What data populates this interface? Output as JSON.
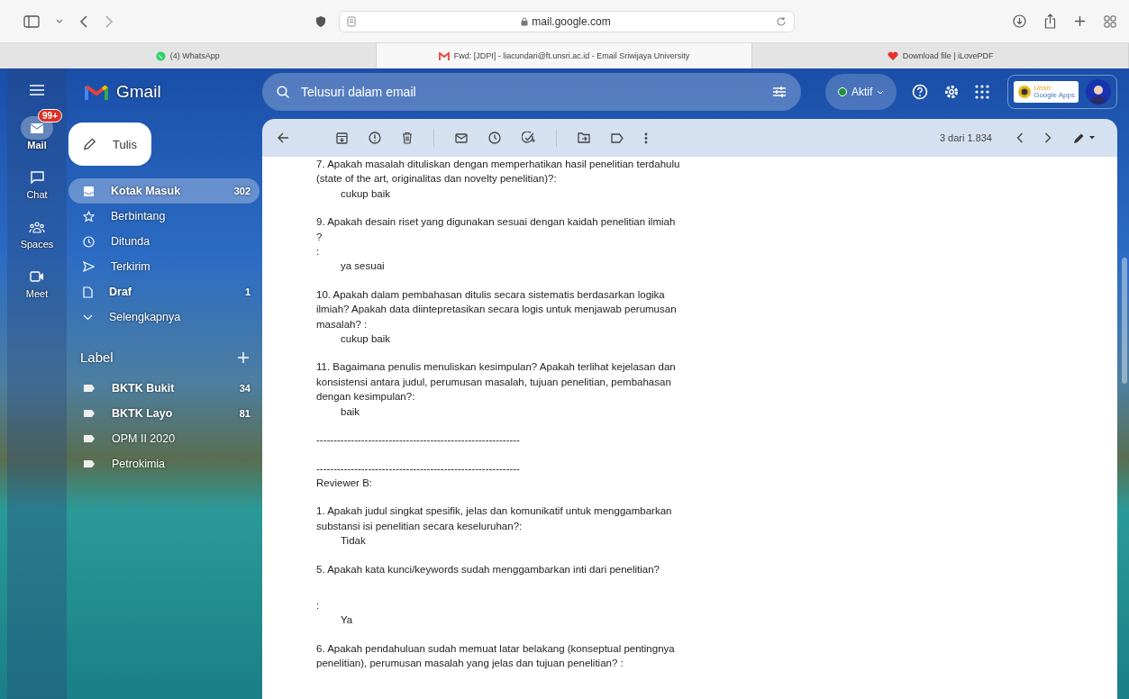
{
  "browser": {
    "address": "mail.google.com",
    "tabs": [
      {
        "title": "(4) WhatsApp",
        "selected": false
      },
      {
        "title": "Fwd: [JDPI] - liacundari@ft.unsri.ac.id - Email Sriwijaya University",
        "selected": true
      },
      {
        "title": "Download file | iLovePDF",
        "selected": false
      }
    ]
  },
  "app": {
    "name": "Gmail",
    "search_placeholder": "Telusuri dalam email",
    "status": "Aktif",
    "org_logo": [
      "Unsri",
      "Google Apps"
    ]
  },
  "rail": [
    {
      "label": "Mail",
      "badge": "99+",
      "selected": true
    },
    {
      "label": "Chat",
      "selected": false
    },
    {
      "label": "Spaces",
      "selected": false
    },
    {
      "label": "Meet",
      "selected": false
    }
  ],
  "compose": "Tulis",
  "folders": [
    {
      "label": "Kotak Masuk",
      "count": "302",
      "selected": true,
      "unread": true
    },
    {
      "label": "Berbintang",
      "selected": false,
      "unread": false
    },
    {
      "label": "Ditunda",
      "selected": false,
      "unread": false
    },
    {
      "label": "Terkirim",
      "selected": false,
      "unread": false
    },
    {
      "label": "Draf",
      "count": "1",
      "selected": false,
      "unread": true
    },
    {
      "label": "Selengkapnya",
      "selected": false,
      "unread": false
    }
  ],
  "labels_title": "Label",
  "labels": [
    {
      "label": "BKTK Bukit",
      "count": "34",
      "unread": true
    },
    {
      "label": "BKTK Layo",
      "count": "81",
      "unread": true
    },
    {
      "label": "OPM II 2020",
      "unread": false
    },
    {
      "label": "Petrokimia",
      "unread": false
    }
  ],
  "pager": "3 dari 1.834",
  "body": [
    {
      "kind": "question",
      "text": "7. Apakah masalah dituliskan dengan memperhatikan hasil penelitian terdahulu (state of the art, originalitas dan novelty penelitian)?:"
    },
    {
      "kind": "answer",
      "text": "cukup baik"
    },
    {
      "kind": "question",
      "text": "9. Apakah desain riset yang digunakan sesuai dengan kaidah penelitian ilmiah"
    },
    {
      "kind": "colon",
      "text": "?"
    },
    {
      "kind": "colon",
      "text": ":"
    },
    {
      "kind": "answer",
      "text": "ya sesuai"
    },
    {
      "kind": "question",
      "text": "10. Apakah dalam pembahasan ditulis secara sistematis berdasarkan logika ilmiah? Apakah data diintepretasikan secara logis untuk menjawab perumusan masalah? :"
    },
    {
      "kind": "answer",
      "text": "cukup baik"
    },
    {
      "kind": "question",
      "text": "11. Bagaimana penulis menuliskan kesimpulan? Apakah terlihat kejelasan dan konsistensi antara judul, perumusan masalah, tujuan penelitian, pembahasan dengan kesimpulan?:"
    },
    {
      "kind": "answer",
      "text": "baik"
    },
    {
      "kind": "question",
      "text": "-----------------------------------------------------------"
    },
    {
      "kind": "question",
      "text": "-----------------------------------------------------------"
    },
    {
      "kind": "line",
      "text": "Reviewer B:"
    },
    {
      "kind": "question",
      "text": "1. Apakah judul singkat spesifik, jelas dan komunikatif untuk menggambarkan substansi isi penelitian secara keseluruhan?:"
    },
    {
      "kind": "answer",
      "text": "Tidak"
    },
    {
      "kind": "question",
      "text": "5. Apakah kata kunci/keywords sudah menggambarkan inti dari penelitian?"
    },
    {
      "kind": "spaced-colon",
      "text": ":"
    },
    {
      "kind": "answer",
      "text": "Ya"
    },
    {
      "kind": "question",
      "text": "6.  Apakah pendahuluan sudah memuat latar belakang (konseptual pentingnya penelitian), perumusan masalah yang jelas dan tujuan penelitian? :"
    }
  ]
}
